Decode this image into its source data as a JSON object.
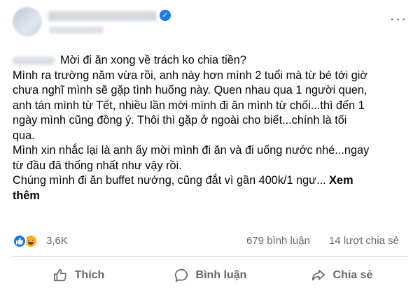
{
  "post": {
    "verified_icon": "check-badge-icon",
    "more_icon": "ellipsis-icon",
    "lines": [
      "Mời đi ăn xong về trách ko chia tiền?",
      "Mình ra trường năm vừa rồi, anh này hơn mình 2 tuổi mà từ bé tới giờ",
      "chưa nghĩ mình sẽ gặp tình huống này. Quen nhau qua 1 người quen,",
      "anh tán mình từ Tết, nhiều lần mời mình đi ăn mình từ chối...thì đến 1",
      "ngày mình cũng đồng ý. Thôi thì gặp ở ngoài cho biết...chính là tối",
      "qua.",
      "Mình xin nhắc lại là anh ấy mời mình đi ăn và đi uống nước nhé...ngay",
      "từ đầu đã thống nhất như vậy rồi.",
      "Chúng mình đi ăn buffet nướng, cũng đắt vì gần 400k/1 ngư... "
    ],
    "see_more_1": "Xem",
    "see_more_2": "thêm"
  },
  "stats": {
    "reaction_icons": [
      "like-icon",
      "haha-icon"
    ],
    "reaction_count": "3,6K",
    "comments": "679 bình luận",
    "shares": "14 lượt chia sẻ"
  },
  "actions": {
    "like": "Thích",
    "comment": "Bình luận",
    "share": "Chia sẻ"
  },
  "colors": {
    "accent": "#1877f2",
    "secondary_text": "#65676b",
    "haha": "#f7b125"
  }
}
